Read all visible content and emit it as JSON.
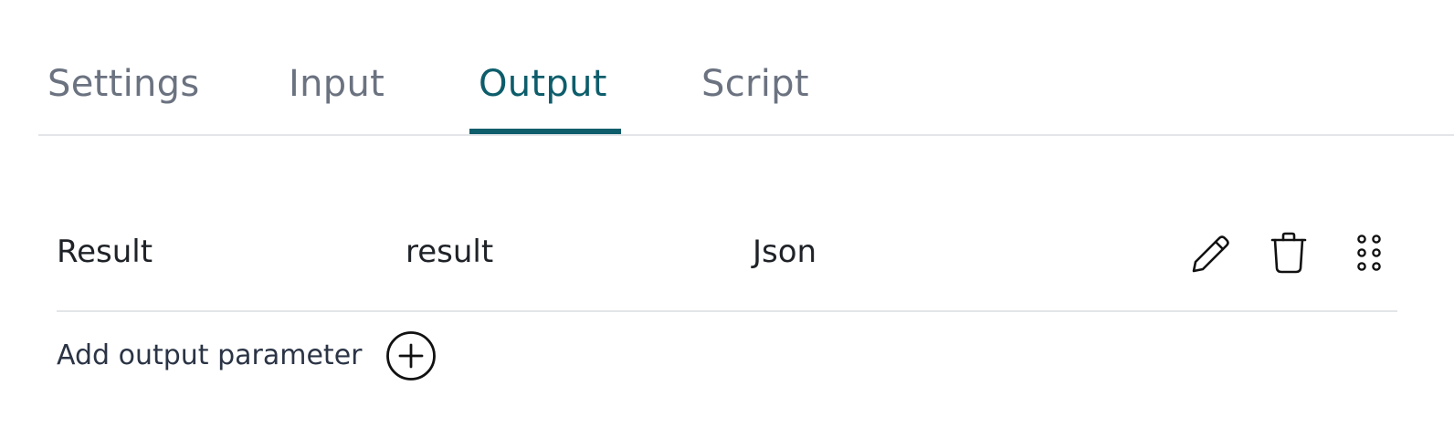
{
  "tabs": {
    "items": [
      {
        "label": "Settings",
        "active": false
      },
      {
        "label": "Input",
        "active": false
      },
      {
        "label": "Output",
        "active": true
      },
      {
        "label": "Script",
        "active": false
      }
    ],
    "active_color": "#0d5d6b",
    "inactive_color": "#6b7280"
  },
  "output_parameters": [
    {
      "name": "Result",
      "key": "result",
      "type": "Json",
      "actions": [
        "pencil-icon",
        "trash-icon",
        "drag-handle-icon"
      ]
    }
  ],
  "add_parameter": {
    "label": "Add output parameter",
    "icon": "plus-circle-icon"
  }
}
